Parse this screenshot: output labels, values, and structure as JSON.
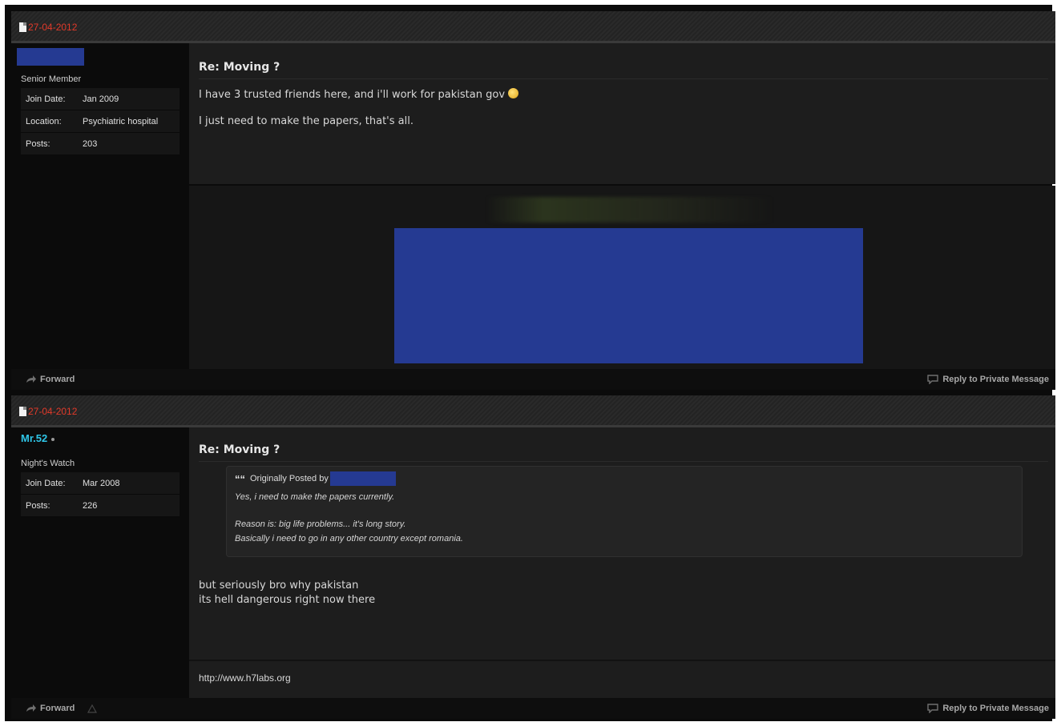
{
  "posts": [
    {
      "date": "27-04-2012",
      "user": {
        "name": "",
        "name_redacted": true,
        "title": "Senior Member",
        "stats": [
          {
            "label": "Join Date:",
            "value": "Jan 2009"
          },
          {
            "label": "Location:",
            "value": "Psychiatric hospital"
          },
          {
            "label": "Posts:",
            "value": "203"
          }
        ]
      },
      "title": "Re: Moving ?",
      "message_lines": [
        "I have 3 trusted friends here, and i'll work for pakistan gov",
        "I just need to make the papers, that's all."
      ],
      "smiley_icon": "smiley-icon",
      "attachment_redacted": true,
      "footer": {
        "forward_label": "Forward",
        "reply_label": "Reply to Private Message"
      }
    },
    {
      "date": "27-04-2012",
      "user": {
        "name": "Mr.52",
        "title": "Night's Watch",
        "stats": [
          {
            "label": "Join Date:",
            "value": "Mar 2008"
          },
          {
            "label": "Posts:",
            "value": "226"
          }
        ]
      },
      "title": "Re: Moving ?",
      "quote": {
        "prefix": "Originally Posted by",
        "author_redacted": true,
        "lines": [
          "Yes, i need to make the papers currently.",
          "Reason is: big life problems... it's long story.",
          "Basically i need to go in any other country except romania."
        ]
      },
      "message_lines": [
        "but seriously bro why pakistan",
        "its hell dangerous right now there"
      ],
      "signature": "http://www.h7labs.org",
      "footer": {
        "forward_label": "Forward",
        "reply_label": "Reply to Private Message"
      }
    }
  ],
  "colors": {
    "date": "#e23a2a",
    "username": "#2fc6e8",
    "redaction": "#253a92",
    "background": "#0b0b0b",
    "content_bg": "#1d1d1d"
  }
}
